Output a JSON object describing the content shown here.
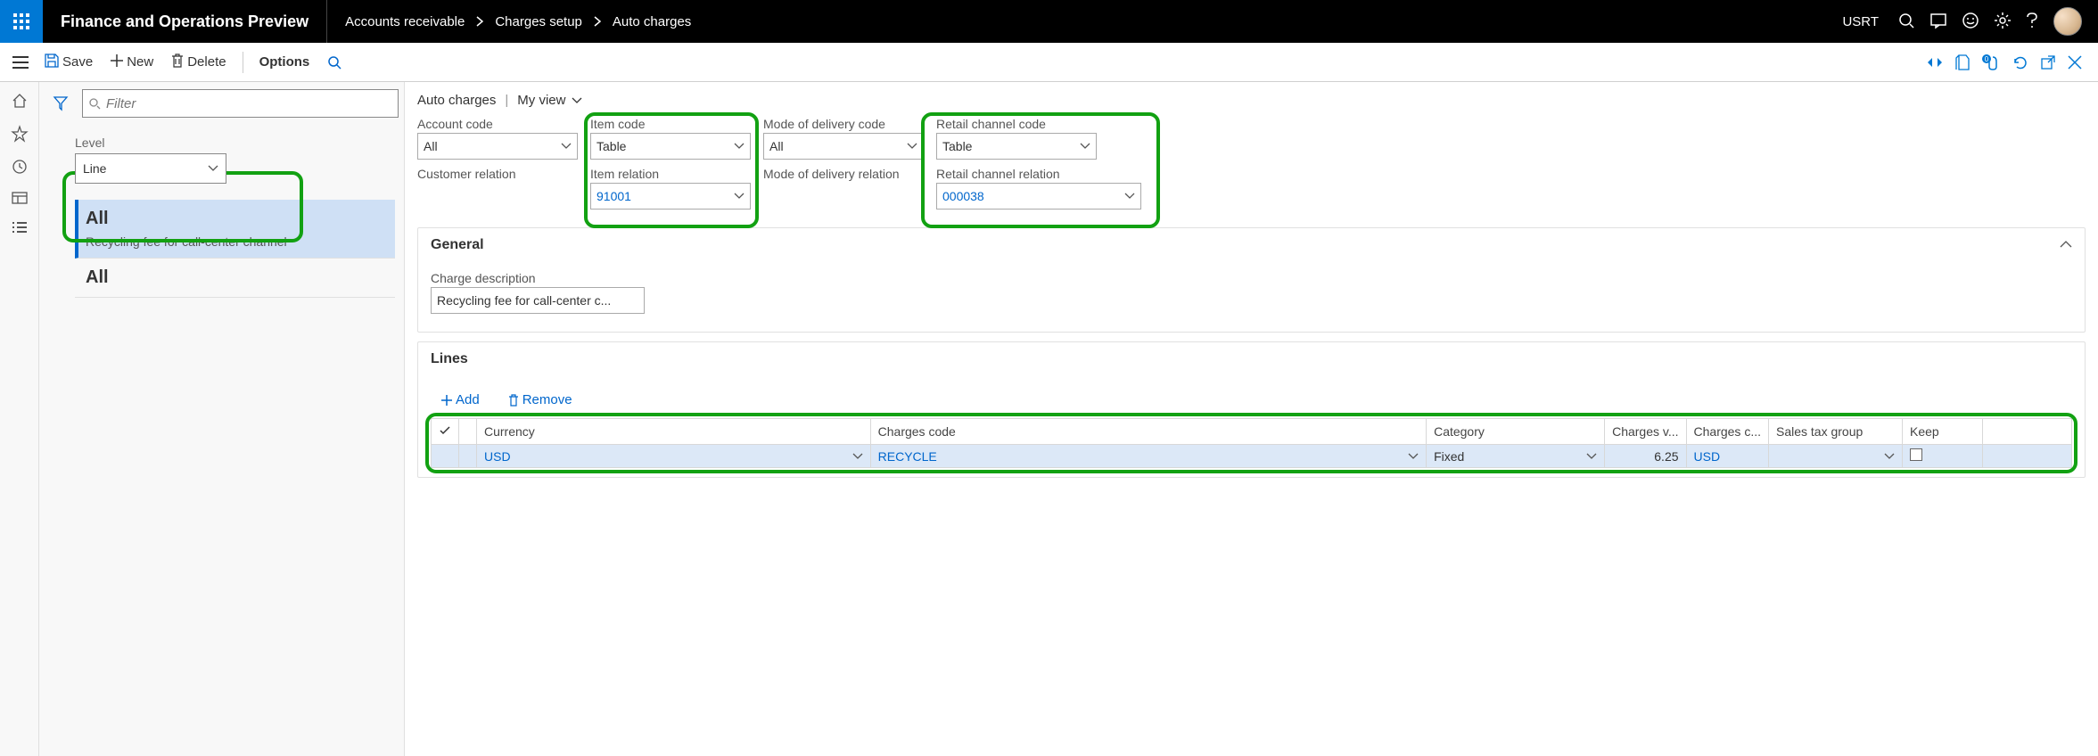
{
  "header": {
    "app_title": "Finance and Operations Preview",
    "breadcrumbs": [
      "Accounts receivable",
      "Charges setup",
      "Auto charges"
    ],
    "user_code": "USRT"
  },
  "toolbar": {
    "save": "Save",
    "new": "New",
    "delete": "Delete",
    "options": "Options"
  },
  "filter": {
    "placeholder": "Filter",
    "level_label": "Level",
    "level_value": "Line",
    "items": [
      {
        "title": "All",
        "sub": "Recycling fee for call-center channel"
      },
      {
        "title": "All",
        "sub": ""
      }
    ]
  },
  "main": {
    "title": "Auto charges",
    "view": "My view",
    "fields": {
      "account_code": {
        "label": "Account code",
        "value": "All"
      },
      "item_code": {
        "label": "Item code",
        "value": "Table"
      },
      "mode_code": {
        "label": "Mode of delivery code",
        "value": "All"
      },
      "retail_code": {
        "label": "Retail channel code",
        "value": "Table"
      },
      "customer_rel": {
        "label": "Customer relation",
        "value": ""
      },
      "item_rel": {
        "label": "Item relation",
        "value": "91001"
      },
      "mode_rel": {
        "label": "Mode of delivery relation",
        "value": ""
      },
      "retail_rel": {
        "label": "Retail channel relation",
        "value": "000038"
      }
    },
    "general": {
      "heading": "General",
      "charge_desc_label": "Charge description",
      "charge_desc_value": "Recycling fee for call-center c..."
    },
    "lines": {
      "heading": "Lines",
      "add": "Add",
      "remove": "Remove",
      "columns": [
        "",
        "",
        "Currency",
        "Charges code",
        "Category",
        "Charges v...",
        "Charges c...",
        "Sales tax group",
        "Keep",
        ""
      ],
      "row": {
        "currency": "USD",
        "code": "RECYCLE",
        "category": "Fixed",
        "value": "6.25",
        "ccur": "USD",
        "tax": "",
        "keep": false
      }
    }
  }
}
